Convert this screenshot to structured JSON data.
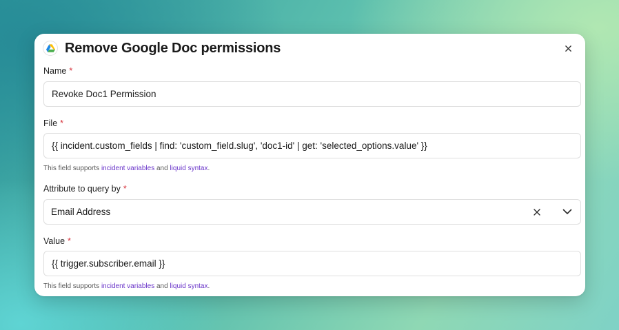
{
  "modal": {
    "title": "Remove Google Doc permissions",
    "app_icon": "google-drive-icon",
    "close_icon": "close-icon"
  },
  "fields": {
    "name": {
      "label": "Name",
      "required_marker": "*",
      "value": "Revoke Doc1 Permission"
    },
    "file": {
      "label": "File",
      "required_marker": "*",
      "value": "{{ incident.custom_fields | find: 'custom_field.slug', 'doc1-id' | get: 'selected_options.value' }}",
      "help": {
        "prefix": "This field supports ",
        "link1": "incident variables",
        "middle": " and ",
        "link2": "liquid syntax",
        "suffix": "."
      }
    },
    "attribute": {
      "label": "Attribute to query by",
      "required_marker": "*",
      "value": "Email Address",
      "clear_icon": "clear-icon",
      "chevron_icon": "chevron-down-icon"
    },
    "value": {
      "label": "Value",
      "required_marker": "*",
      "value": "{{ trigger.subscriber.email }}",
      "help": {
        "prefix": "This field supports ",
        "link1": "incident variables",
        "middle": " and ",
        "link2": "liquid syntax",
        "suffix": "."
      }
    }
  },
  "colors": {
    "required": "#d7343d",
    "link": "#6a35c9",
    "modal_bg": "#ffffff"
  }
}
